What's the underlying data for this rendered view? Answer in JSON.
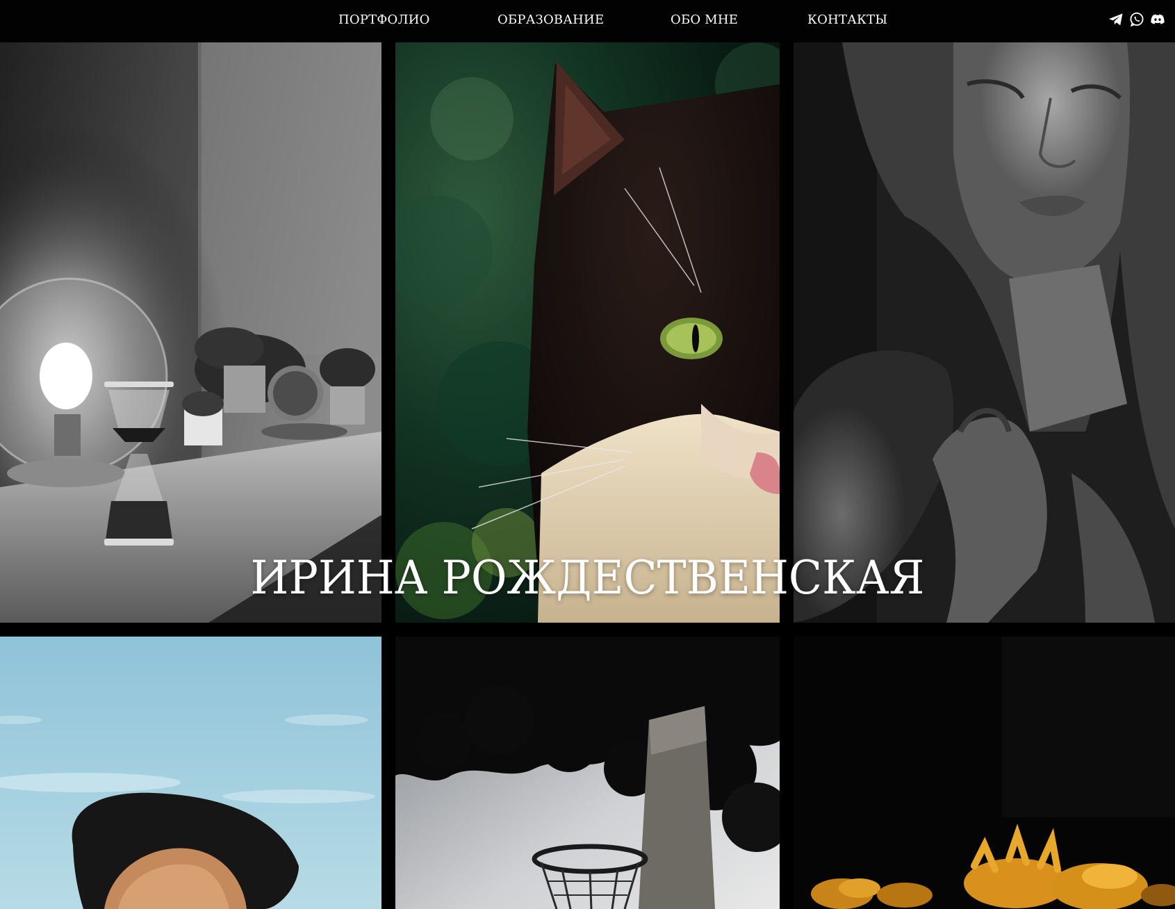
{
  "nav": {
    "items": [
      {
        "label": "ПОРТФОЛИО"
      },
      {
        "label": "ОБРАЗОВАНИЕ"
      },
      {
        "label": "ОБО МНЕ"
      },
      {
        "label": "КОНТАКТЫ"
      }
    ],
    "social": [
      {
        "icon": "telegram-icon"
      },
      {
        "icon": "whatsapp-icon"
      },
      {
        "icon": "discord-icon"
      }
    ]
  },
  "hero": {
    "name": "ИРИНА РОЖДЕСТВЕНСКАЯ"
  },
  "colors": {
    "background": "#000000",
    "text": "#ffffff",
    "flower_accent": "#d9901c",
    "sky": "#8fc3d8"
  }
}
